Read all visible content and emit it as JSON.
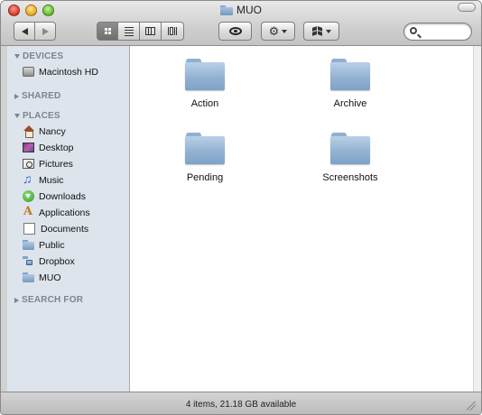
{
  "window": {
    "title": "MUO"
  },
  "toolbar": {
    "view_modes": [
      "icon-view",
      "list-view",
      "column-view",
      "cover-flow-view"
    ],
    "selected_view": "icon-view",
    "search_placeholder": ""
  },
  "sidebar": {
    "sections": [
      {
        "label": "DEVICES",
        "expanded": true,
        "items": [
          {
            "label": "Macintosh HD",
            "icon": "hard-drive-icon"
          }
        ]
      },
      {
        "label": "SHARED",
        "expanded": false,
        "items": []
      },
      {
        "label": "PLACES",
        "expanded": true,
        "items": [
          {
            "label": "Nancy",
            "icon": "home-icon"
          },
          {
            "label": "Desktop",
            "icon": "desktop-icon"
          },
          {
            "label": "Pictures",
            "icon": "pictures-icon"
          },
          {
            "label": "Music",
            "icon": "music-icon"
          },
          {
            "label": "Downloads",
            "icon": "downloads-icon"
          },
          {
            "label": "Applications",
            "icon": "applications-icon"
          },
          {
            "label": "Documents",
            "icon": "documents-icon"
          },
          {
            "label": "Public",
            "icon": "folder-icon"
          },
          {
            "label": "Dropbox",
            "icon": "dropbox-folder-icon"
          },
          {
            "label": "MUO",
            "icon": "folder-icon"
          }
        ]
      },
      {
        "label": "SEARCH FOR",
        "expanded": false,
        "items": []
      }
    ]
  },
  "content": {
    "items": [
      {
        "label": "Action",
        "icon": "folder-icon"
      },
      {
        "label": "Archive",
        "icon": "folder-icon"
      },
      {
        "label": "Pending",
        "icon": "folder-icon"
      },
      {
        "label": "Screenshots",
        "icon": "folder-icon"
      }
    ]
  },
  "status": {
    "text": "4 items, 21.18 GB available"
  },
  "colors": {
    "sidebar_bg": "#dde4ec",
    "section_header": "#7a8593",
    "folder_blue": "#92b2d2"
  }
}
